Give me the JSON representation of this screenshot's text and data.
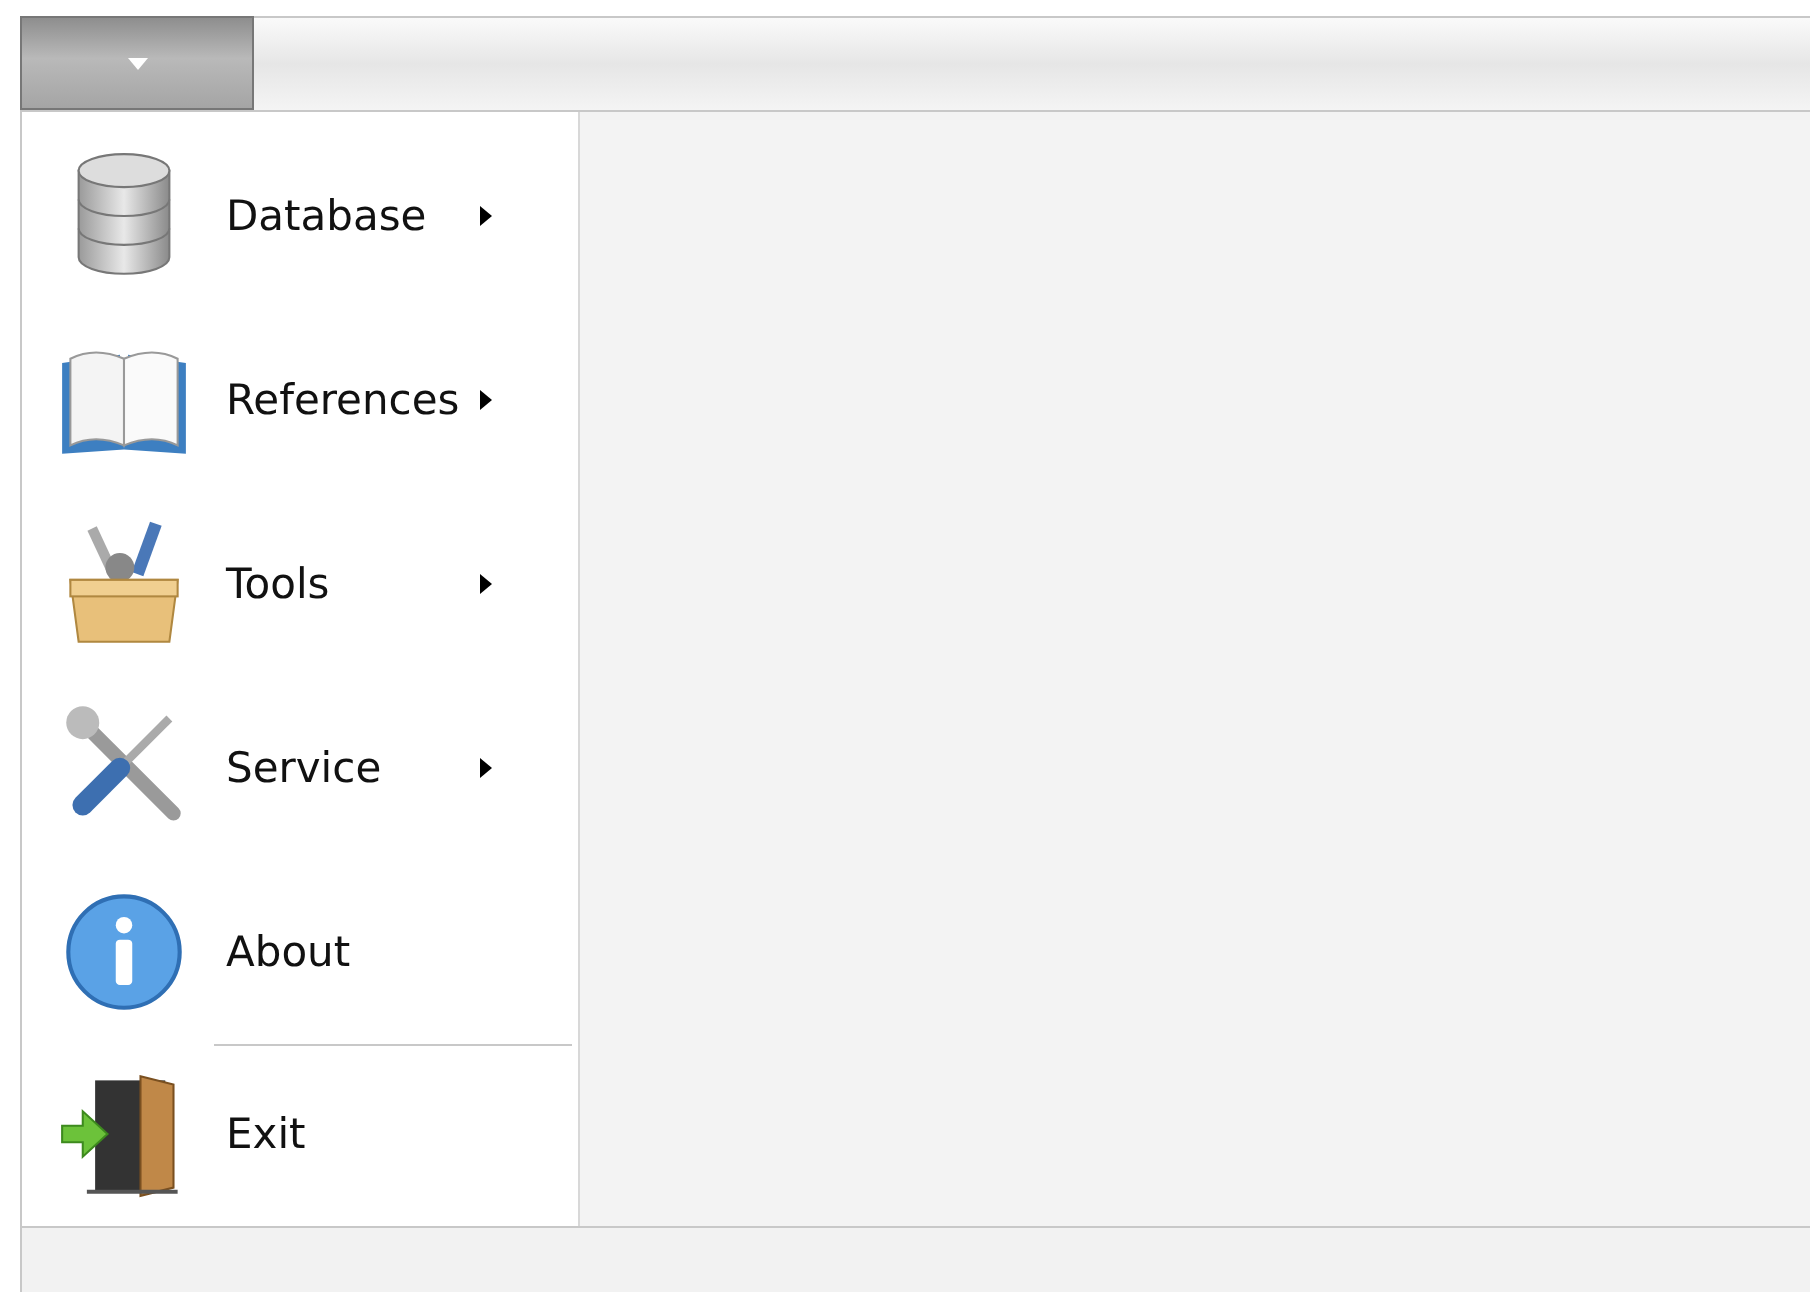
{
  "menu": {
    "items": [
      {
        "label": "Database",
        "submenu": true,
        "separator_before": false
      },
      {
        "label": "References",
        "submenu": true,
        "separator_before": false
      },
      {
        "label": "Tools",
        "submenu": true,
        "separator_before": false
      },
      {
        "label": "Service",
        "submenu": true,
        "separator_before": false
      },
      {
        "label": "About",
        "submenu": false,
        "separator_before": false
      },
      {
        "label": "Exit",
        "submenu": false,
        "separator_before": true
      }
    ]
  }
}
